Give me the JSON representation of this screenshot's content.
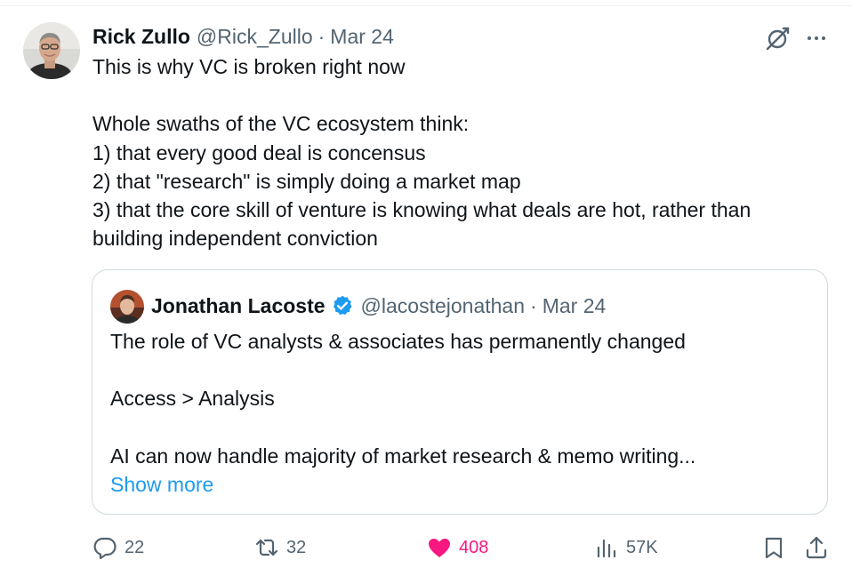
{
  "tweet": {
    "author_name": "Rick Zullo",
    "author_handle": "@Rick_Zullo",
    "separator": "·",
    "date": "Mar 24",
    "text_lines": [
      "This is why VC is broken right now",
      "",
      "Whole swaths of the VC ecosystem think:",
      "1) that every good deal is concensus",
      "2) that \"research\" is simply doing a market map",
      "3) that the core skill of venture is knowing what deals are hot, rather than",
      "building independent conviction"
    ],
    "icons": [
      "grok-icon",
      "more-icon"
    ]
  },
  "quote": {
    "author_name": "Jonathan Lacoste",
    "author_handle": "@lacostejonathan",
    "separator": "·",
    "date": "Mar 24",
    "verified_icon": "verified-badge-icon",
    "text_lines": [
      "The role of VC analysts & associates has permanently changed",
      "",
      "Access > Analysis",
      "",
      "AI can now handle majority of market research & memo writing..."
    ],
    "show_more_label": "Show more"
  },
  "actions": {
    "reply_count": "22",
    "retweet_count": "32",
    "like_count": "408",
    "views_count": "57K",
    "liked": true
  },
  "colors": {
    "text": "#0f1419",
    "muted": "#536471",
    "link": "#1d9bf0",
    "like": "#f91880",
    "border": "#cfd9de"
  }
}
